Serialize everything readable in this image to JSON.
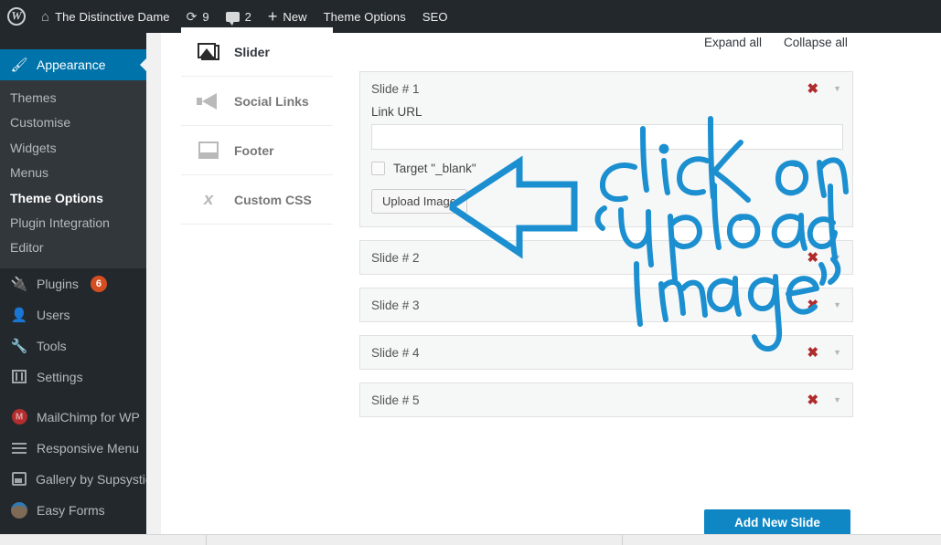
{
  "adminbar": {
    "site_title": "The Distinctive Dame",
    "updates_count": "9",
    "comments_count": "2",
    "new_label": "New",
    "theme_options_label": "Theme Options",
    "seo_label": "SEO",
    "icons": {
      "wordpress": "wordpress-logo-icon",
      "home": "home-icon",
      "updates": "updates-icon",
      "comments": "comment-icon",
      "new": "plus-icon"
    }
  },
  "sidebar": {
    "current": "Appearance",
    "items": [
      {
        "label": "Appearance",
        "icon": "paintbrush-icon",
        "current": true
      },
      {
        "label": "Plugins",
        "icon": "plug-icon",
        "badge": "6"
      },
      {
        "label": "Users",
        "icon": "user-icon"
      },
      {
        "label": "Tools",
        "icon": "wrench-icon"
      },
      {
        "label": "Settings",
        "icon": "sliders-icon"
      },
      {
        "label": "MailChimp for WP",
        "icon": "mailchimp-icon"
      },
      {
        "label": "Responsive Menu",
        "icon": "hamburger-icon"
      },
      {
        "label": "Gallery by Supsystic",
        "icon": "gallery-icon"
      },
      {
        "label": "Easy Forms",
        "icon": "easyforms-icon"
      }
    ],
    "submenu": [
      {
        "label": "Themes",
        "active": false
      },
      {
        "label": "Customise",
        "active": false
      },
      {
        "label": "Widgets",
        "active": false
      },
      {
        "label": "Menus",
        "active": false
      },
      {
        "label": "Theme Options",
        "active": true
      },
      {
        "label": "Plugin Integration",
        "active": false
      },
      {
        "label": "Editor",
        "active": false
      }
    ]
  },
  "tabs": [
    {
      "label": "Slider",
      "icon": "images-icon",
      "active": true
    },
    {
      "label": "Social Links",
      "icon": "megaphone-icon",
      "active": false
    },
    {
      "label": "Footer",
      "icon": "footer-box-icon",
      "active": false
    },
    {
      "label": "Custom CSS",
      "icon": "css3-icon",
      "active": false
    }
  ],
  "panel": {
    "expand_all": "Expand all",
    "collapse_all": "Collapse all",
    "add_new_slide": "Add New Slide",
    "accent_color": "#0e87c4",
    "delete_color": "#b02b2b"
  },
  "slides": [
    {
      "title": "Slide # 1",
      "expanded": true,
      "link_url_label": "Link URL",
      "link_url_value": "",
      "link_url_placeholder": "",
      "target_blank_label": "Target \"_blank\"",
      "target_blank_checked": false,
      "upload_image_label": "Upload Image"
    },
    {
      "title": "Slide # 2",
      "expanded": false
    },
    {
      "title": "Slide # 3",
      "expanded": false
    },
    {
      "title": "Slide # 4",
      "expanded": false
    },
    {
      "title": "Slide # 5",
      "expanded": false
    }
  ],
  "annotation": {
    "color": "#1b8fd0",
    "arrow": "left-pointing-arrow",
    "text_line1": "click on",
    "text_line2": "'upload",
    "text_line3": "Image'",
    "full_text": "click on 'Upload Image'"
  }
}
